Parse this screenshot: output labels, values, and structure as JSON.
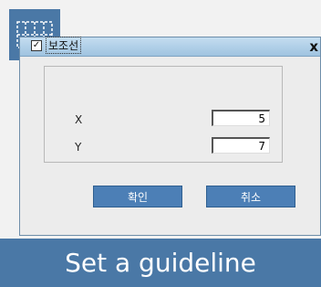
{
  "app_icon": "guideline-grid-icon",
  "dialog": {
    "close_label": "x",
    "checkbox": {
      "mark": "✓",
      "label": "보조선",
      "checked": true
    },
    "fields": [
      {
        "label": "X",
        "value": "5"
      },
      {
        "label": "Y",
        "value": "7"
      }
    ],
    "ok_label": "확인",
    "cancel_label": "취소"
  },
  "caption": "Set a guideline"
}
